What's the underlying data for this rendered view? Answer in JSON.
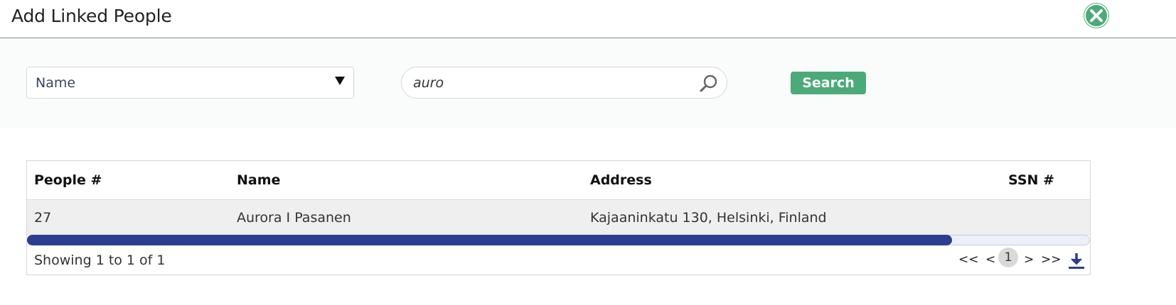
{
  "dialog": {
    "title": "Add Linked People",
    "close_icon": "close-icon"
  },
  "filter": {
    "field_select": {
      "selected": "Name"
    },
    "search": {
      "value": "auro",
      "icon": "search-icon"
    },
    "search_button": "Search"
  },
  "table": {
    "columns": [
      "People #",
      "Name",
      "Address",
      "SSN #"
    ],
    "rows": [
      {
        "people_no": "27",
        "name": "Aurora I Pasanen",
        "address": "Kajaaninkatu 130, Helsinki, Finland",
        "ssn": ""
      }
    ],
    "scroll_position_fraction": 0.87,
    "summary": "Showing 1 to 1 of 1",
    "pagination": {
      "first": "<<",
      "prev": "<",
      "current": "1",
      "next": ">",
      "last": ">>"
    },
    "download_icon": "download-icon"
  },
  "colors": {
    "accent_green": "#4caa78",
    "scroll_thumb": "#2c3e91"
  }
}
